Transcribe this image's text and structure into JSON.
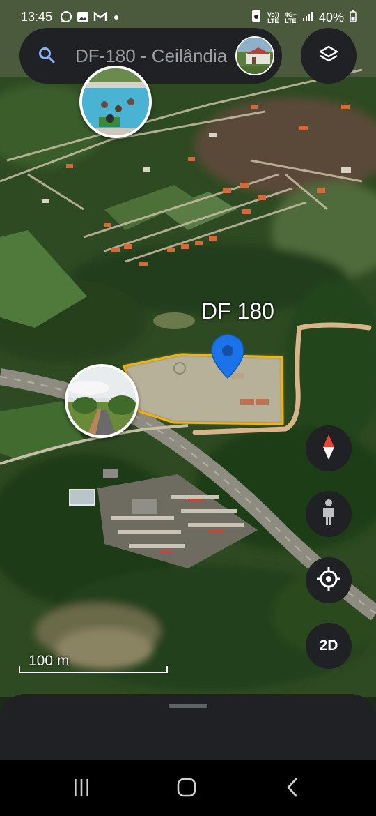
{
  "status_bar": {
    "time": "13:45",
    "notification_icons": [
      "whatsapp-icon",
      "gallery-icon",
      "gmail-icon",
      "dot-icon"
    ],
    "system_icons": [
      "nfc-icon",
      "volte-icon",
      "4g-icon",
      "signal-icon"
    ],
    "volte_top": "Vo))",
    "volte_bottom": "LTE",
    "network_top": "4G+",
    "network_bottom": "LTE",
    "battery": "40%"
  },
  "search": {
    "value": "DF-180 - Ceilândia",
    "icon": "search-icon"
  },
  "controls": {
    "layers_icon": "layers-icon",
    "compass_icon": "compass-icon",
    "pegman_icon": "pegman-icon",
    "my_location_icon": "my-location-icon",
    "view_mode_label": "2D"
  },
  "map": {
    "place_label": "DF 180",
    "scale_label": "100 m",
    "colors": {
      "pin": "#1a73e8",
      "boundary": "#f4b400",
      "panel": "#202124",
      "compass_north": "#ea4335"
    }
  },
  "navigation": {
    "buttons": [
      "recent-apps",
      "home",
      "back"
    ]
  }
}
